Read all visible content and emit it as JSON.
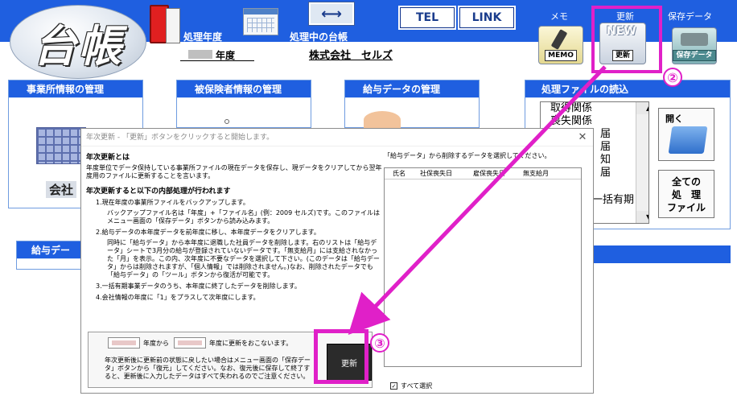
{
  "header": {
    "logo_text": "台帳",
    "label_year": "処理年度",
    "label_ledger": "処理中の台帳",
    "tel_label": "TEL",
    "link_label": "LINK",
    "memo_top": "メモ",
    "update_top": "更新",
    "save_top": "保存データ",
    "memo_caption": "MEMO",
    "update_new": "NEW",
    "update_caption": "更新",
    "save_caption": "保存データ",
    "arrow_glyph": "⟷"
  },
  "subheader": {
    "year_suffix": "年度",
    "company": "株式会社　セルズ"
  },
  "panels": {
    "office": "事業所情報の管理",
    "office_button": "会社",
    "insured": "被保険者情報の管理",
    "salary": "給与データの管理",
    "file_read": "処理ファイルの読込",
    "salary_bottom": "給与デー"
  },
  "file_list": [
    "取得関係",
    "喪失関係",
    "届",
    "届",
    "知",
    "届",
    "",
    "一括有期"
  ],
  "file_buttons": {
    "open": "開く",
    "all_files": [
      "全ての",
      "処　理",
      "ファイル"
    ]
  },
  "dialog": {
    "title": "年次更新 - 「更新」ボタンをクリックすると開始します。",
    "close": "✕",
    "h_what": "年次更新とは",
    "p_what": "年度単位でデータ保持している事業所ファイルの現在データを保存し、現データをクリアしてから翌年度用のファイルに更新することを言います。",
    "h_process": "年次更新すると以下の内部処理が行われます",
    "step1": "1.現在年度の事業所ファイルをバックアップします。",
    "step1_sub": "バックアップファイル名は「年度」+「ファイル名」(例：2009 セルズ)です。このファイルはメニュー画面の「保存データ」ボタンから読み込みます。",
    "step2": "2.給与データの本年度データを前年度に移し、本年度データをクリアします。",
    "step2_sub": "同時に「給与データ」から本年度に退職した社員データを削除します。右のリストは「給与データ」シートで3月分の給与が登録されていないデータです。「無支給月」には支給されなかった「月」を表示。この内、次年度に不要なデータを選択して下さい。(このデータは「給与データ」からは削除されますが、「個人情報」では削除されません。)なお、削除されたデータでも「給与データ」の「ツール」ボタンから復活が可能です。",
    "step3": "3.一括有期事業データのうち、本年度に終了したデータを削除します。",
    "step4": "4.会社情報の年度に「1」をプラスして次年度にします。",
    "yr_from_text": "年度から",
    "yr_to_text": "年度に更新をおこないます。",
    "warn": "年次更新後に更新前の状態に戻したい場合はメニュー画面の「保存データ」ボタンから「復元」してください。なお、復元後に保存して終了すると、更新後に入力したデータはすべて失われるのでご注意ください。",
    "exec_button": "更新",
    "right_caption": "「給与データ」から削除するデータを選択してください。",
    "columns": [
      "氏名",
      "社保喪失日",
      "雇保喪失日",
      "無支給月"
    ],
    "select_all": "すべて選択",
    "select_all_check": "✓"
  },
  "annotations": {
    "num2": "②",
    "num3": "③",
    "color": "#e020c8"
  }
}
